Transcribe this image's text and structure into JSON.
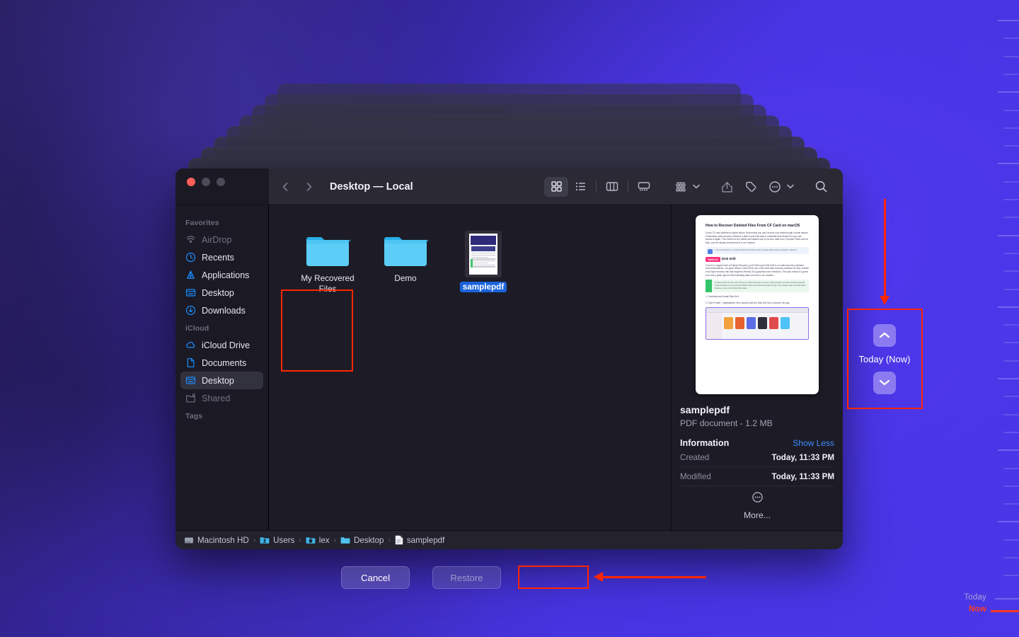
{
  "window": {
    "title": "Desktop — Local",
    "traffic_lights": [
      "close",
      "minimize",
      "maximize"
    ]
  },
  "toolbar": {
    "back_icon": "chevron-left-icon",
    "forward_icon": "chevron-right-icon",
    "buttons": [
      {
        "name": "icon-view-button",
        "icon": "grid-view-icon",
        "active": true
      },
      {
        "name": "list-view-button",
        "icon": "list-view-icon",
        "active": false
      },
      {
        "name": "column-view-button",
        "icon": "column-view-icon",
        "active": false
      },
      {
        "name": "gallery-view-button",
        "icon": "gallery-view-icon",
        "active": false
      },
      {
        "name": "group-by-button",
        "icon": "group-by-icon",
        "active": false
      },
      {
        "name": "share-button",
        "icon": "share-icon",
        "active": false
      },
      {
        "name": "tag-button",
        "icon": "tag-icon",
        "active": false
      },
      {
        "name": "more-actions-button",
        "icon": "ellipsis-circle-icon",
        "active": false
      },
      {
        "name": "search-button",
        "icon": "search-icon",
        "active": false
      }
    ]
  },
  "sidebar": {
    "sections": [
      {
        "header": "Favorites",
        "items": [
          {
            "label": "AirDrop",
            "icon": "airdrop-icon",
            "state": "dim"
          },
          {
            "label": "Recents",
            "icon": "clock-icon",
            "state": "normal"
          },
          {
            "label": "Applications",
            "icon": "applications-icon",
            "state": "normal"
          },
          {
            "label": "Desktop",
            "icon": "desktop-icon",
            "state": "normal"
          },
          {
            "label": "Downloads",
            "icon": "downloads-icon",
            "state": "normal"
          }
        ]
      },
      {
        "header": "iCloud",
        "items": [
          {
            "label": "iCloud Drive",
            "icon": "cloud-icon",
            "state": "normal"
          },
          {
            "label": "Documents",
            "icon": "document-icon",
            "state": "normal"
          },
          {
            "label": "Desktop",
            "icon": "desktop-icon",
            "state": "selected"
          },
          {
            "label": "Shared",
            "icon": "shared-folder-icon",
            "state": "dim"
          }
        ]
      },
      {
        "header": "Tags",
        "items": []
      }
    ]
  },
  "files": [
    {
      "name": "My Recovered Files",
      "kind": "folder",
      "selected": false
    },
    {
      "name": "Demo",
      "kind": "folder",
      "selected": false
    },
    {
      "name": "samplepdf",
      "kind": "pdf",
      "selected": true
    }
  ],
  "preview": {
    "file_name": "samplepdf",
    "file_kind": "PDF document - 1.2 MB",
    "information_header": "Information",
    "show_less_label": "Show Less",
    "rows": [
      {
        "key": "Created",
        "value": "Today, 11:33 PM"
      },
      {
        "key": "Modified",
        "value": "Today, 11:33 PM"
      }
    ],
    "more_label": "More...",
    "more_icon": "ellipsis-circle-icon",
    "document": {
      "heading": "How to Recover Deleted Files From CF Card on macOS",
      "paragraph": "If your CF card suffered a logical failure, that means you can't access your data through normal means. Fortunately, data recovery software is able to pull that data or metadata and rebuild it so you can access it again. This method is the safest and easiest way to recover data from Compact Flash card on Mac, and we always recommend it to our readers.",
      "note": "In the next sections, we demonstrate this process with 2 popular data recovery software. Read on.",
      "option_badge": "Option A:",
      "option_title": "Disk Drill",
      "option_paragraph": "If you're a regular here at Handy Recovery, you'll often spot Disk Drill in our data recovery software recommendations - for good reason. Disk Drill is one of the best data recovery software for Mac, thanks to its high recovery rate and beginner-friendly GUI (graphical user interface). This also makes it a great reco and a great app for demonstrating data recovery to our readers.",
      "green_note": "It's also perfect for CF card recovery on Mac (and other memory cards typically used with cameras, like SD cards) because you can preview RAW photos and videos through the app. For a deeper dive into Disk Drill's features, read our full Disk Drill review.",
      "steps": [
        "1. Download and install Disk Drill.",
        "2. Open Finder > Applications, then double-click the Disk Drill icon to launch the app."
      ]
    }
  },
  "pathbar": {
    "crumbs": [
      {
        "label": "Macintosh HD",
        "icon": "hard-drive-icon"
      },
      {
        "label": "Users",
        "icon": "users-folder-icon"
      },
      {
        "label": "lex",
        "icon": "home-folder-icon"
      },
      {
        "label": "Desktop",
        "icon": "folder-icon"
      },
      {
        "label": "samplepdf",
        "icon": "pdf-file-icon"
      }
    ],
    "separator": "›"
  },
  "footer": {
    "cancel_label": "Cancel",
    "restore_label": "Restore",
    "restore_disabled": true
  },
  "time_machine": {
    "up_arrow_icon": "chevron-up-icon",
    "down_arrow_icon": "chevron-down-icon",
    "current_label": "Today (Now)",
    "timeline": {
      "today_label": "Today",
      "now_label": "Now",
      "now_color": "#ff2600"
    }
  },
  "annotations": {
    "highlight_color": "#ff2600",
    "boxes": [
      "selected-file",
      "restore-button",
      "time-machine-nav"
    ],
    "arrows": [
      "arrow-to-time-machine-nav",
      "arrow-to-restore-button"
    ]
  },
  "colors": {
    "accent_blue": "#3c8cff",
    "selection_blue": "#1b63dd",
    "folder_blue": "#4fc3f7",
    "annotation_red": "#ff2600",
    "backdrop_purple": "#4a37e8"
  }
}
